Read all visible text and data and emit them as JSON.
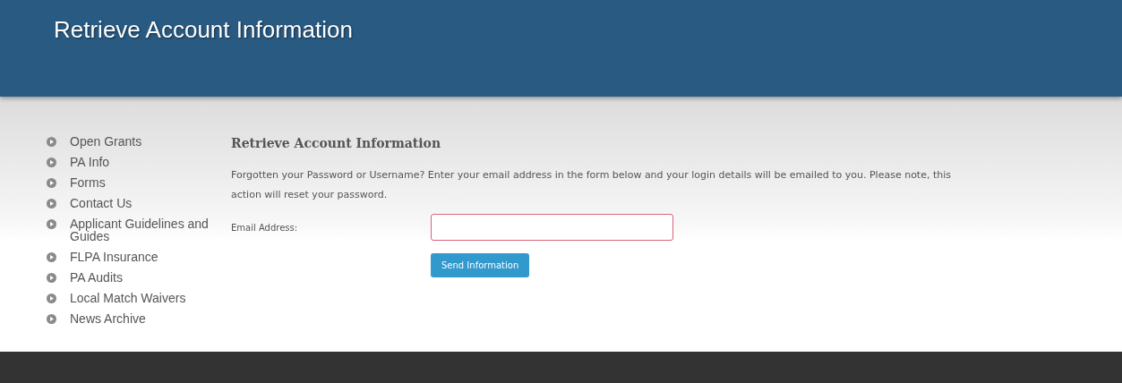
{
  "header": {
    "title": "Retrieve Account Information"
  },
  "sidebar": {
    "items": [
      {
        "label": "Open Grants"
      },
      {
        "label": "PA Info"
      },
      {
        "label": "Forms"
      },
      {
        "label": "Contact Us"
      },
      {
        "label": "Applicant Guidelines and Guides"
      },
      {
        "label": "FLPA Insurance"
      },
      {
        "label": "PA Audits"
      },
      {
        "label": "Local Match Waivers"
      },
      {
        "label": "News Archive"
      }
    ]
  },
  "content": {
    "heading": "Retrieve Account Information",
    "intro": "Forgotten your Password or Username? Enter your email address in the form below and your login details will be emailed to you. Please note, this action will reset your password.",
    "email_label": "Email Address:",
    "email_invalid": true,
    "submit": "Send Information"
  }
}
